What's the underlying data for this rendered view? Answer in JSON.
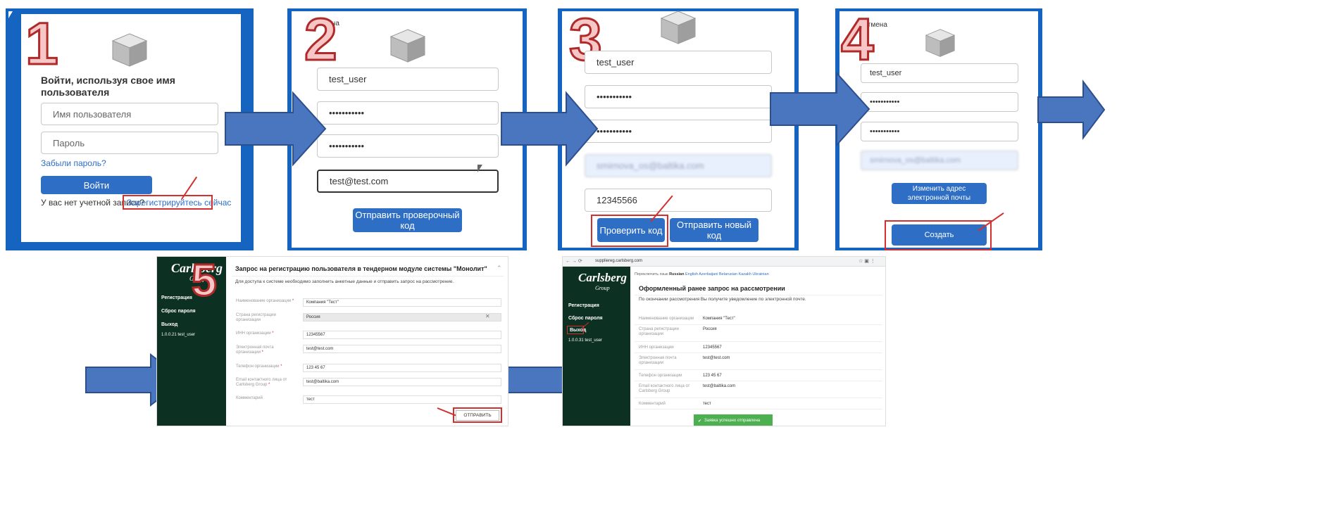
{
  "steps": {
    "n1": "1",
    "n2": "2",
    "n3": "3",
    "n4": "4",
    "n5": "5"
  },
  "panel1": {
    "title": "Войти, используя свое имя пользователя",
    "username_placeholder": "Имя пользователя",
    "password_placeholder": "Пароль",
    "forgot_link": "Забыли пароль?",
    "login_button": "Войти",
    "no_account": "У вас нет учетной записи?",
    "register_link": "Зарегистрируйтесь сейчас"
  },
  "panel2": {
    "cancel": "Отмена",
    "username": "test_user",
    "password": "•••••••••••",
    "password_repeat": "•••••••••••",
    "email": "test@test.com",
    "send_code_button": "Отправить проверочный код"
  },
  "panel3": {
    "username": "test_user",
    "password": "•••••••••••",
    "password_repeat": "•••••••••••",
    "email_blurred": "smirnova_os@baltika.com",
    "code": "12345566",
    "verify_button": "Проверить код",
    "resend_button": "Отправить новый код"
  },
  "panel4": {
    "cancel": "Отмена",
    "username": "test_user",
    "password": "•••••••••••",
    "password_repeat": "•••••••••••",
    "email_blurred": "smirnova_os@baltika.com",
    "change_email_button": "Изменить адрес электронной почты",
    "create_button": "Создать"
  },
  "panel5": {
    "logo": "Carlsberg",
    "logo_sub": "Group",
    "sidebar": [
      "Регистрация",
      "Сброс пароля",
      "Выход"
    ],
    "version": "1.0.0.21 test_user",
    "title": "Запрос на регистрацию пользователя в тендерном модуле системы \"Монолит\"",
    "subtitle": "Для доступа к системе необходимо заполнить анкетные данные и отправить запрос на рассмотрение.",
    "fields": [
      {
        "label": "Наименование организации",
        "req": "*",
        "value": "Компания \"Тест\""
      },
      {
        "label": "Страна регистрации организации",
        "req": "",
        "value": "Россия"
      },
      {
        "label": "ИНН организации",
        "req": "*",
        "value": "12345567"
      },
      {
        "label": "Электронная почта организации",
        "req": "*",
        "value": "test@test.com"
      },
      {
        "label": "Телефон организации",
        "req": "*",
        "value": "123 45 67"
      },
      {
        "label": "Email контактного лица от Carlsberg Group",
        "req": "*",
        "value": "test@baltika.com"
      },
      {
        "label": "Комментарий",
        "req": "",
        "value": "тест"
      }
    ],
    "submit_button": "ОТПРАВИТЬ"
  },
  "panel6": {
    "url": "suppliereg.carlsberg.com",
    "lang_prefix": "Переключить язык",
    "lang_active": "Russian",
    "langs": "English Azerbaijani Belarusian Kazakh Ukrainian",
    "logo": "Carlsberg",
    "logo_sub": "Group",
    "sidebar": [
      "Регистрация",
      "Сброс пароля",
      "Выход"
    ],
    "version": "1.0.0.31 test_user",
    "title": "Оформленный ранее запрос на рассмотрении",
    "subtitle": "По окончании рассмотрения Вы получите уведомление по электронной почте.",
    "fields": [
      {
        "label": "Наименование организации",
        "value": "Компания \"Тест\""
      },
      {
        "label": "Страна регистрации организации",
        "value": "Россия"
      },
      {
        "label": "ИНН организации",
        "value": "12345567"
      },
      {
        "label": "Электронная почта организации",
        "value": "test@test.com"
      },
      {
        "label": "Телефон организации",
        "value": "123 45 67"
      },
      {
        "label": "Email контактного лица от Carlsberg Group",
        "value": "test@baltika.com"
      },
      {
        "label": "Комментарий",
        "value": "тест"
      }
    ],
    "toast": "Заявка успешно отправлена"
  },
  "colors": {
    "primary": "#2e6ec5",
    "panel_blue": "#1565c0",
    "arrow": "#4a76c0",
    "accent_red": "#d32f2f",
    "sidebar_green": "#0c3021"
  }
}
